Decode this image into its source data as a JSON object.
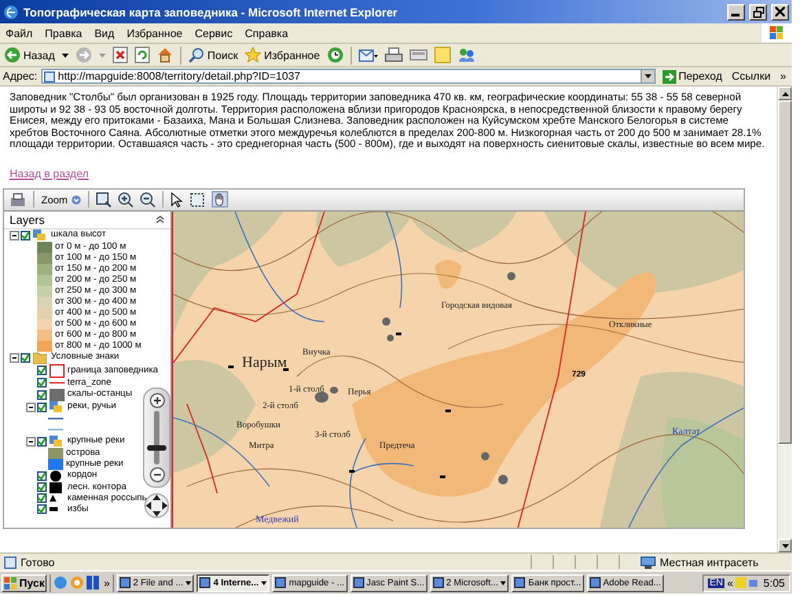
{
  "window": {
    "title": "Топографическая карта заповедника - Microsoft Internet Explorer"
  },
  "menu": [
    "Файл",
    "Правка",
    "Вид",
    "Избранное",
    "Сервис",
    "Справка"
  ],
  "toolbar": {
    "back": "Назад",
    "search": "Поиск",
    "favorites": "Избранное"
  },
  "address": {
    "label": "Адрес:",
    "value": "http://mapguide:8008/territory/detail.php?ID=1037",
    "go": "Переход",
    "links": "Ссылки",
    "more": "»"
  },
  "page": {
    "paragraph": "Заповедник \"Столбы\" был организован в 1925 году. Площадь территории заповедника 470 кв. км, географические координаты: 55 38 - 55 58 северной широты и 92 38 - 93 05 восточной долготы. Территория расположена вблизи пригородов Красноярска, в непосредственной близости к правому берегу Енисея, между его притоками - Базаиха, Мана и Большая Слизнева. Заповедник расположен на Куйсумском хребте Манского Белогорья в системе хребтов Восточного Саяна. Абсолютные отметки этого междуречья колеблются в пределах 200-800 м. Низкогорная часть от 200 до 500 м занимает 28.1% площади территории. Оставшаяся часть - это среднегорная часть (500 - 800м), где и выходят на поверхность сиенитовые скалы, известные во всем мире.",
    "back_link": "Назад в раздел"
  },
  "map_viewer": {
    "zoom_label": "Zoom",
    "layers_title": "Layers",
    "layers": [
      {
        "label": "шкала высот",
        "kind": "group",
        "checked": true,
        "expanded": true,
        "children": [
          {
            "label": "от 0 м - до 100 м",
            "kind": "swatch",
            "color": "#6e8558"
          },
          {
            "label": "от 100 м - до 150 м",
            "kind": "swatch",
            "color": "#879767"
          },
          {
            "label": "от 150 м - до 200 м",
            "kind": "swatch",
            "color": "#9db27a"
          },
          {
            "label": "от 200 м - до 250 м",
            "kind": "swatch",
            "color": "#b3c493"
          },
          {
            "label": "от 250 м - до 300 м",
            "kind": "swatch",
            "color": "#c6cfa8"
          },
          {
            "label": "от 300 м - до 400 м",
            "kind": "swatch",
            "color": "#d8d4b3"
          },
          {
            "label": "от 400 м - до 500 м",
            "kind": "swatch",
            "color": "#e4d0ad"
          },
          {
            "label": "от 500 м - до 600 м",
            "kind": "swatch",
            "color": "#f4d3ab"
          },
          {
            "label": "от 600 м - до 800 м",
            "kind": "swatch",
            "color": "#f4be83"
          },
          {
            "label": "от 800 м - до 1000 м",
            "kind": "swatch",
            "color": "#f0a858"
          }
        ]
      },
      {
        "label": "Условные знаки",
        "kind": "folder",
        "checked": true,
        "expanded": true,
        "children": [
          {
            "label": "граница заповедника",
            "kind": "outline",
            "checked": true
          },
          {
            "label": "terra_zone",
            "kind": "line",
            "checked": true
          },
          {
            "label": "скалы-останцы",
            "kind": "block",
            "checked": true
          },
          {
            "label": "реки, ручьи",
            "kind": "group",
            "checked": true,
            "expanded": true,
            "children": [
              {
                "kind": "stream",
                "color": "#3d6fb0"
              },
              {
                "kind": "stream",
                "color": "#8fb4e0"
              }
            ]
          },
          {
            "label": "крупные реки",
            "kind": "group",
            "checked": true,
            "expanded": true,
            "children": [
              {
                "label": "острова",
                "kind": "swatch",
                "color": "#8e9668"
              },
              {
                "label": "крупные реки",
                "kind": "swatch",
                "color": "#1f78f0"
              }
            ]
          },
          {
            "label": "кордон",
            "kind": "dot",
            "checked": true
          },
          {
            "label": "лесн. контора",
            "kind": "square",
            "checked": true
          },
          {
            "label": "каменная россыпь",
            "kind": "mark",
            "checked": true
          },
          {
            "label": "избы",
            "kind": "dash",
            "checked": true
          }
        ]
      }
    ],
    "zoom_slider": {
      "level": 0.3
    },
    "map_labels": [
      {
        "text": "Нарым",
        "kind": "town"
      },
      {
        "text": "Внучка",
        "kind": "rock"
      },
      {
        "text": "1-й столб",
        "kind": "rock"
      },
      {
        "text": "2-й столб",
        "kind": "rock"
      },
      {
        "text": "Перья",
        "kind": "rock"
      },
      {
        "text": "Воробушки",
        "kind": "rock"
      },
      {
        "text": "Митра",
        "kind": "rock"
      },
      {
        "text": "3-й столб",
        "kind": "rock"
      },
      {
        "text": "Предтеча",
        "kind": "rock"
      },
      {
        "text": "Городская видовая",
        "kind": "rock"
      },
      {
        "text": "Откликные",
        "kind": "rock"
      },
      {
        "text": "729",
        "kind": "height"
      },
      {
        "text": "Калтат",
        "kind": "river"
      },
      {
        "text": "Медвежий",
        "kind": "river"
      }
    ]
  },
  "status_bar": {
    "text": "Готово",
    "zone": "Местная интрасеть"
  },
  "taskbar": {
    "start": "Пуск",
    "more": "»",
    "tasks": [
      {
        "label": "2 File and ...",
        "selected": false,
        "grouped": true
      },
      {
        "label": "4 Interne...",
        "selected": true,
        "grouped": true
      },
      {
        "label": "mapguide - ...",
        "selected": false,
        "grouped": false
      },
      {
        "label": "Jasc Paint S...",
        "selected": false,
        "grouped": false
      },
      {
        "label": "2 Microsoft...",
        "selected": false,
        "grouped": true
      },
      {
        "label": "Банк прост...",
        "selected": false,
        "grouped": false
      },
      {
        "label": "Adobe Read...",
        "selected": false,
        "grouped": false
      }
    ],
    "language": "EN",
    "tray_more": "«",
    "time": "5:05"
  }
}
